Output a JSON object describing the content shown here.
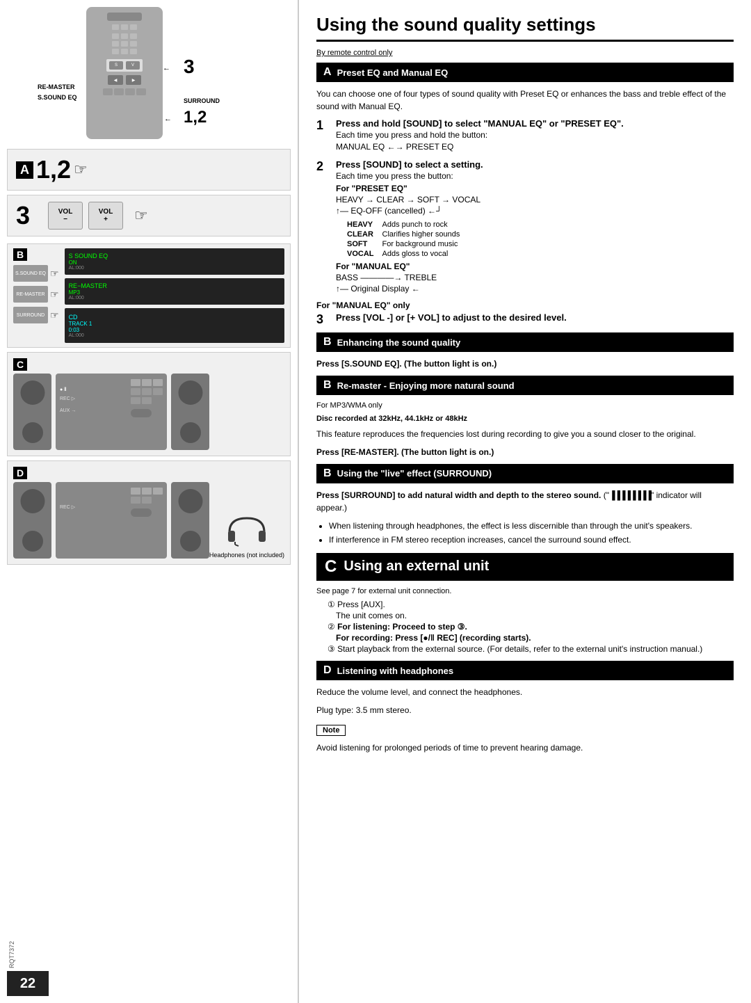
{
  "page": {
    "number": "22",
    "catalog": "RQT7372"
  },
  "left": {
    "annotation_3": "3",
    "annotation_12": "1,2",
    "re_master_label": "RE-MASTER",
    "s_sound_eq_label": "S.SOUND EQ",
    "surround_label": "SURROUND",
    "vol_minus": "VOL\n−",
    "vol_plus": "VOL\n+",
    "section_a_label": "A 1, 2",
    "section_3_label": "3",
    "section_b_label": "B",
    "section_c_label": "C",
    "section_d_label": "D",
    "s_sound_eq_display": "S SOUND EQ\nON",
    "re_master_display": "RE−MASTER\nMP3",
    "cd_track_display": "CD\nTRACK  1\n0:03",
    "headphones_label": "Headphones\n(not included)"
  },
  "right": {
    "main_title": "Using the sound quality settings",
    "remote_only": "By remote control only",
    "section_a": {
      "header": "Preset EQ and Manual EQ",
      "letter": "A",
      "body": "You can choose one of four types of sound quality with Preset EQ or enhances the bass and treble effect of the sound with Manual EQ.",
      "step1_bold": "Press and hold [SOUND] to select \"MANUAL EQ\" or \"PRESET EQ\".",
      "step1_sub": "Each time you press and hold the button:",
      "step1_arrow": "MANUAL EQ ←→ PRESET EQ",
      "step2_bold": "Press [SOUND] to select a setting.",
      "step2_sub": "Each time you press the button:",
      "for_preset": "For \"PRESET EQ\"",
      "preset_arrow": "HEAVY → CLEAR → SOFT → VOCAL",
      "preset_arrow2": "↑— EQ-OFF (cancelled) ←┘",
      "heavy_desc": "Adds punch to rock",
      "clear_desc": "Clarifies higher sounds",
      "soft_desc": "For background music",
      "vocal_desc": "Adds gloss to vocal",
      "for_manual": "For \"MANUAL EQ\"",
      "manual_arrow": "BASS ————→ TREBLE",
      "manual_arrow2": "↑— Original Display ←",
      "manual_only": "For \"MANUAL EQ\" only",
      "step3_bold": "Press [VOL -] or [+ VOL] to adjust to the desired level."
    },
    "section_b1": {
      "header": "Enhancing the sound quality",
      "letter": "B",
      "body": "Press [S.SOUND EQ]. (The button light is on.)"
    },
    "section_b2": {
      "header": "Re-master - Enjoying more natural sound",
      "letter": "B",
      "mp3_only": "For MP3/WMA only",
      "disc_label": "Disc recorded at 32kHz, 44.1kHz or 48kHz",
      "body": "This feature reproduces the frequencies lost during recording to give you a sound closer to the original.",
      "press": "Press [RE-MASTER]. (The button light is on.)"
    },
    "section_b3": {
      "header": "Using the \"live\" effect (SURROUND)",
      "letter": "B",
      "bold1": "Press [SURROUND] to add natural width and depth to the stereo sound.",
      "surround_indicator": "\" ▐▐▐▐▐▐▐▐ \" indicator will appear.",
      "bullet1": "When listening through headphones, the effect is less discernible than through the unit's speakers.",
      "bullet2": "If interference in FM stereo reception increases, cancel the surround sound effect."
    },
    "section_c": {
      "title": "Using an external unit",
      "letter": "C",
      "see_page": "See page 7 for external unit connection.",
      "step1": "Press [AUX].",
      "step1b": "The unit comes on.",
      "step2_listening": "For listening: Proceed to step ③.",
      "step2_recording": "For recording: Press [●/‖ REC] (recording starts).",
      "step3": "Start playback from the external source. (For details, refer to the external unit's instruction manual.)"
    },
    "section_d": {
      "header": "Listening with headphones",
      "letter": "D",
      "body": "Reduce the volume level, and connect the headphones.",
      "plug": "Plug type: 3.5 mm stereo.",
      "note_label": "Note",
      "note_body": "Avoid listening for prolonged periods of time to prevent hearing damage."
    }
  }
}
